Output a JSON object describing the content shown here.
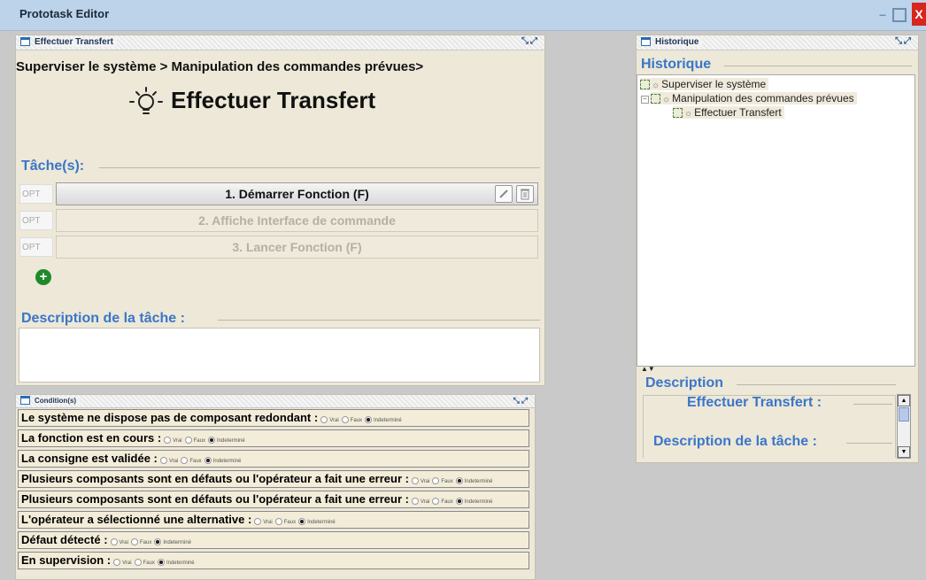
{
  "app": {
    "title": "Prototask Editor"
  },
  "panel_main": {
    "title": "Effectuer Transfert",
    "breadcrumb": "Superviser le système > Manipulation des commandes prévues>",
    "task_title": "Effectuer Transfert",
    "tasks_label": "Tâche(s):",
    "tasks": [
      {
        "opt": "OPT",
        "label": "1. Démarrer Fonction (F)"
      },
      {
        "opt": "OPT",
        "label": "2. Affiche Interface de commande"
      },
      {
        "opt": "OPT",
        "label": "3. Lancer Fonction (F)"
      }
    ],
    "description_label": "Description de la tâche :"
  },
  "panel_conditions": {
    "title": "Condition(s)",
    "radio_labels": [
      "Vrai",
      "Faux",
      "Indeterminé"
    ],
    "rows": [
      {
        "label": "Le système ne dispose pas de composant redondant :",
        "selected": "Indeterminé"
      },
      {
        "label": "La fonction est en cours :",
        "selected": "Indeterminé"
      },
      {
        "label": "La consigne est validée :",
        "selected": "Indeterminé"
      },
      {
        "label": "Plusieurs composants sont en défauts ou l'opérateur a fait une erreur :",
        "selected": "Indeterminé"
      },
      {
        "label": "Plusieurs composants sont en défauts ou l'opérateur a fait une erreur :",
        "selected": "Indeterminé"
      },
      {
        "label": "L'opérateur a sélectionné une alternative :",
        "selected": "Indeterminé"
      },
      {
        "label": "Défaut détecté :",
        "selected": "Indeterminé"
      },
      {
        "label": "En supervision :",
        "selected": "Indeterminé"
      }
    ]
  },
  "panel_history": {
    "title": "Historique",
    "group_title": "Historique",
    "tree": [
      "Superviser le système",
      "Manipulation des commandes prévues",
      "Effectuer Transfert"
    ],
    "description_label": "Description",
    "desc_task": "Effectuer Transfert :",
    "desc_task_desc": "Description de la tâche :"
  },
  "colors": {
    "accent": "#3a76c8",
    "panel_bg": "#ede8d8",
    "titlebar": "#bcd3ea"
  }
}
